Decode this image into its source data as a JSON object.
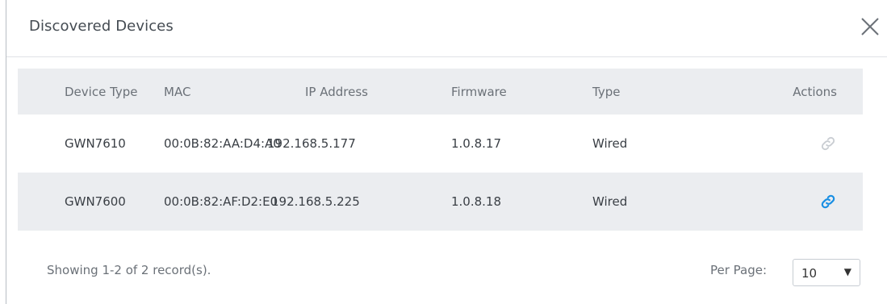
{
  "dialog": {
    "title": "Discovered Devices"
  },
  "table": {
    "columns": [
      "Device Type",
      "MAC",
      "IP Address",
      "Firmware",
      "Type",
      "Actions"
    ],
    "rows": [
      {
        "device_type": "GWN7610",
        "mac": "00:0B:82:AA:D4:A0",
        "ip": "192.168.5.177",
        "firmware": "1.0.8.17",
        "type": "Wired",
        "action_icon": "link-icon",
        "action_enabled": false
      },
      {
        "device_type": "GWN7600",
        "mac": "00:0B:82:AF:D2:E0",
        "ip": "192.168.5.225",
        "firmware": "1.0.8.18",
        "type": "Wired",
        "action_icon": "link-icon",
        "action_enabled": true
      }
    ]
  },
  "footer": {
    "records_text": "Showing 1-2 of 2 record(s).",
    "per_page_label": "Per Page:",
    "per_page_value": "10"
  },
  "colors": {
    "link_active": "#1a8fe3",
    "link_disabled": "#c9cdd2",
    "row_alt_bg": "#ebedf0"
  }
}
